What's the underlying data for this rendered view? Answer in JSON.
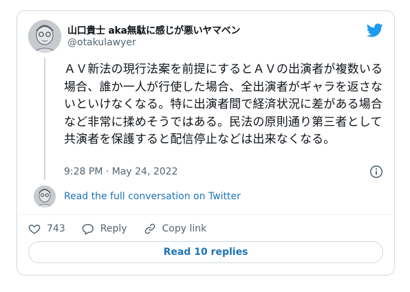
{
  "tweet": {
    "display_name": "山口貴士 aka無駄に感じが悪いヤマベン",
    "handle": "@otakulawyer",
    "text": "ＡＶ新法の現行法案を前提にするとＡＶの出演者が複数いる場合、誰か一人が行使した場合、全出演者がギャラを返さないといけなくなる。特に出演者間で経済状況に差がある場合など非常に揉めそうではある。民法の原則通り第三者として共演者を保護すると配信停止などは出来なくなる。",
    "timestamp": "9:28 PM · May 24, 2022"
  },
  "conversation": {
    "read_full_label": "Read the full conversation on Twitter"
  },
  "actions": {
    "like_count": "743",
    "reply_label": "Reply",
    "copy_link_label": "Copy link"
  },
  "footer": {
    "read_replies_label": "Read 10 replies"
  },
  "icons": {
    "brand": "twitter-bird-icon",
    "info": "info-icon",
    "like": "heart-icon",
    "reply": "reply-bubble-icon",
    "copy": "link-icon"
  },
  "colors": {
    "brand_blue": "#1d9bf0",
    "link_blue": "#1d74b7",
    "text_primary": "#0f1419",
    "text_secondary": "#536471",
    "border": "#cfd9de"
  }
}
